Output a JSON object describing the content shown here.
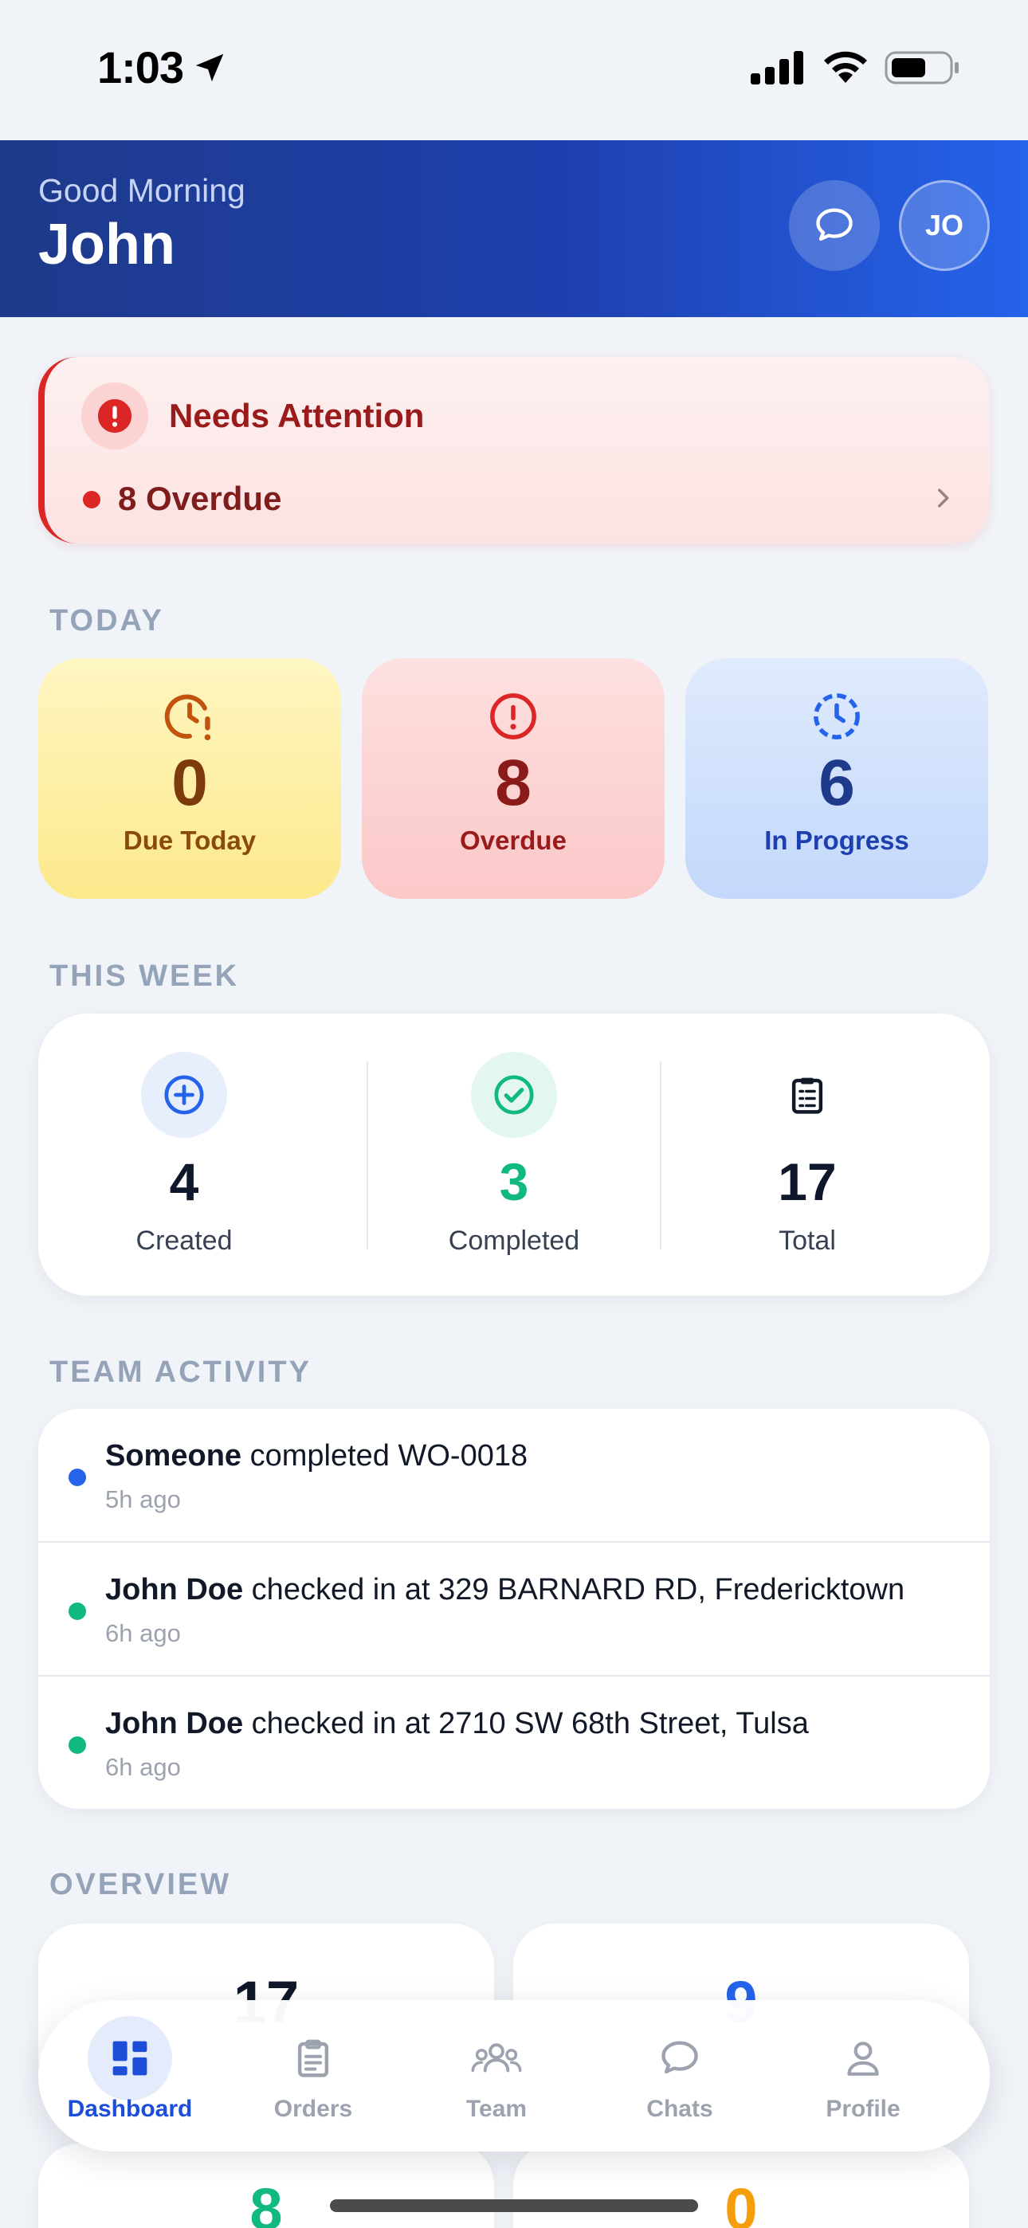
{
  "status_bar": {
    "time": "1:03"
  },
  "header": {
    "greeting": "Good Morning",
    "name": "John",
    "avatar_initials": "JO"
  },
  "attention": {
    "title": "Needs Attention",
    "item": "8 Overdue"
  },
  "today": {
    "label": "TODAY",
    "cards": [
      {
        "value": "0",
        "label": "Due Today",
        "icon": "clock-alert-icon"
      },
      {
        "value": "8",
        "label": "Overdue",
        "icon": "alert-circle-icon"
      },
      {
        "value": "6",
        "label": "In Progress",
        "icon": "clock-dashed-icon"
      }
    ]
  },
  "week": {
    "label": "THIS WEEK",
    "stats": [
      {
        "value": "4",
        "label": "Created",
        "icon": "plus-circle-icon"
      },
      {
        "value": "3",
        "label": "Completed",
        "icon": "check-circle-icon"
      },
      {
        "value": "17",
        "label": "Total",
        "icon": "clipboard-list-icon"
      }
    ]
  },
  "activity": {
    "label": "TEAM ACTIVITY",
    "items": [
      {
        "actor": "Someone",
        "action": " completed WO-0018",
        "time": "5h ago"
      },
      {
        "actor": "John Doe",
        "action": " checked in at 329 BARNARD RD, Fredericktown",
        "time": "6h ago"
      },
      {
        "actor": "John Doe",
        "action": " checked in at 2710 SW 68th Street, Tulsa",
        "time": "6h ago"
      }
    ]
  },
  "overview": {
    "label": "OVERVIEW",
    "values": [
      "17",
      "9",
      "8",
      "0"
    ]
  },
  "nav": {
    "items": [
      {
        "label": "Dashboard",
        "icon": "dashboard-icon"
      },
      {
        "label": "Orders",
        "icon": "clipboard-icon"
      },
      {
        "label": "Team",
        "icon": "team-icon"
      },
      {
        "label": "Chats",
        "icon": "chat-icon"
      },
      {
        "label": "Profile",
        "icon": "profile-icon"
      }
    ]
  },
  "colors": {
    "primary": "#1e40af",
    "danger": "#dc2626",
    "success": "#10b981",
    "warning": "#f59e0b",
    "info": "#2563eb"
  }
}
